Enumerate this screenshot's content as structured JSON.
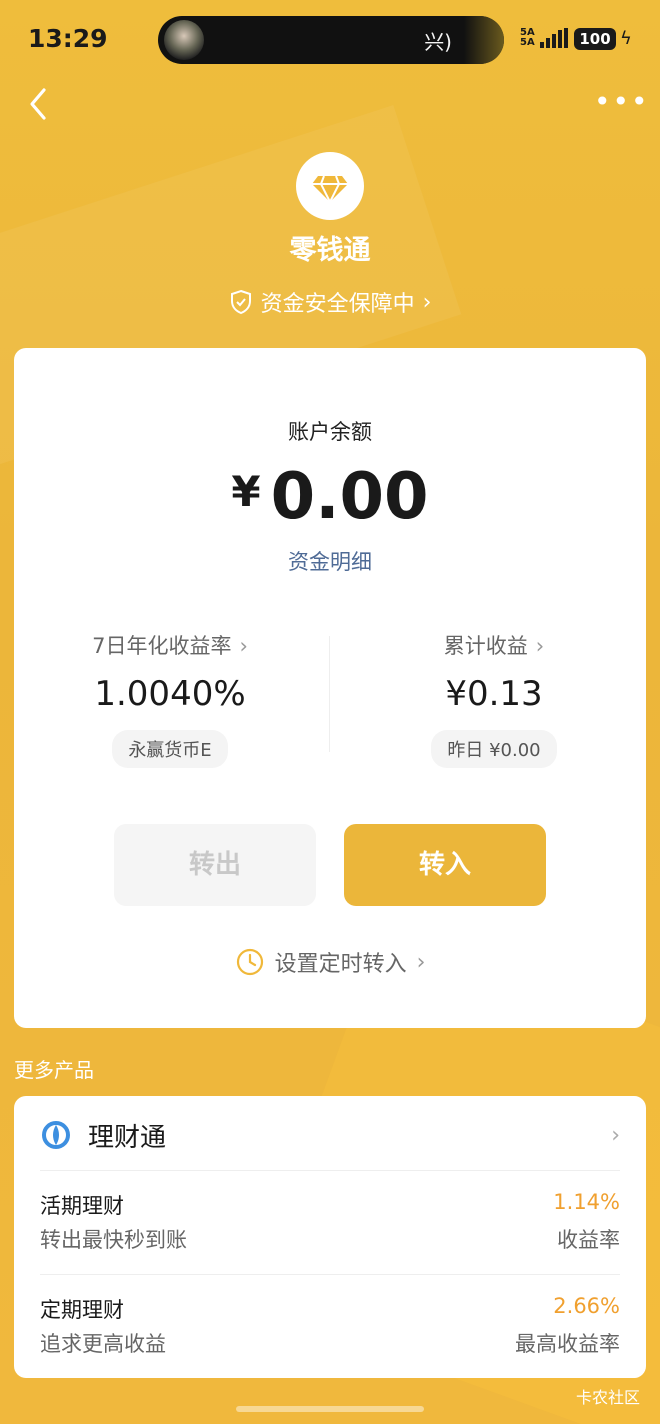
{
  "status_bar": {
    "time": "13:29",
    "island_text": "兴)",
    "signal_label": "5A\n5A",
    "battery": "100"
  },
  "header": {
    "title": "零钱通",
    "safety": "资金安全保障中"
  },
  "balance": {
    "label": "账户余额",
    "currency": "¥",
    "amount": "0.00",
    "detail_link": "资金明细"
  },
  "stats": {
    "yield_label": "7日年化收益率",
    "yield_value": "1.0040%",
    "fund_name": "永赢货币E",
    "cumulative_label": "累计收益",
    "cumulative_value": "¥0.13",
    "yesterday": "昨日 ¥0.00"
  },
  "actions": {
    "withdraw": "转出",
    "deposit": "转入",
    "schedule": "设置定时转入"
  },
  "more_products": {
    "section_label": "更多产品",
    "product_name": "理财通",
    "items": [
      {
        "title": "活期理财",
        "subtitle": "转出最快秒到账",
        "rate": "1.14%",
        "rate_label": "收益率"
      },
      {
        "title": "定期理财",
        "subtitle": "追求更高收益",
        "rate": "2.66%",
        "rate_label": "最高收益率"
      }
    ]
  },
  "watermark": "卡农社区",
  "colors": {
    "accent": "#ebb63a",
    "link": "#4f6b96",
    "rate": "#f0a02f"
  }
}
